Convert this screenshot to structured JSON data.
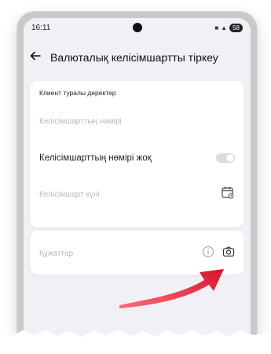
{
  "status_bar": {
    "time": "16:11",
    "battery": "58"
  },
  "header": {
    "back_icon": "arrow-left-icon",
    "title": "Валюталық келісімшартты тіркеу"
  },
  "client_section": {
    "title": "Клиент туралы деректер",
    "contract_number_placeholder": "Келісімшарттың нөмірі",
    "no_contract_toggle_label": "Келісімшарттың нөмірі жоқ",
    "contract_date_placeholder": "Келісімшарт күні",
    "calendar_icon": "calendar-icon"
  },
  "documents_section": {
    "label": "Құжаттар",
    "info_icon": "info-icon",
    "camera_icon": "camera-icon"
  },
  "colors": {
    "accent_arrow": "#e0283c",
    "screen_bg": "#f1f1f5"
  }
}
